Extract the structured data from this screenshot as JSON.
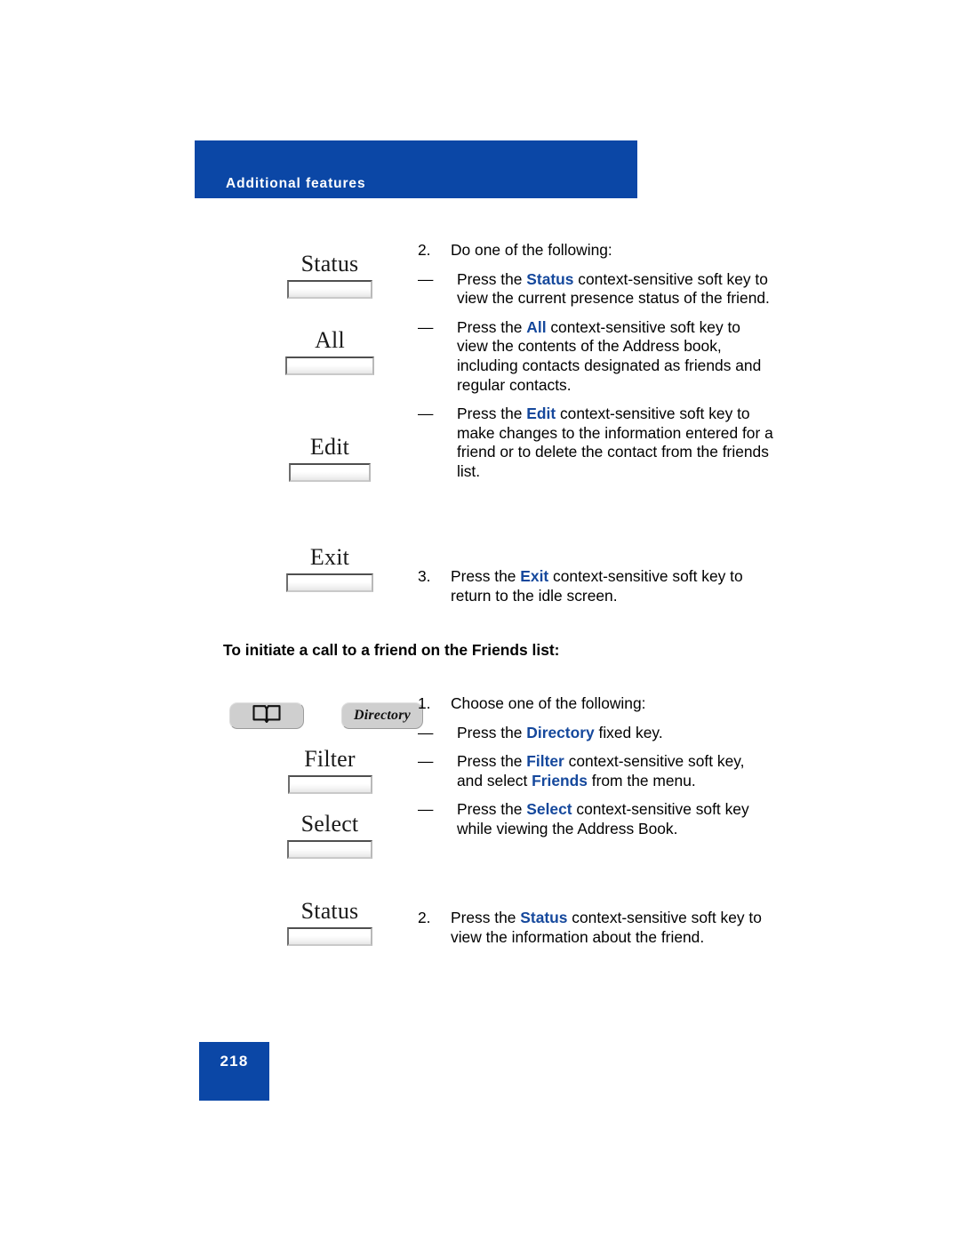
{
  "header": {
    "title": "Additional features"
  },
  "footer": {
    "page_number": "218"
  },
  "colors": {
    "brand_blue": "#0B47A6",
    "keyword_blue": "#15489C",
    "key_pill_gray": "#CFCFCF"
  },
  "softkeys": [
    {
      "label": "Status",
      "name": "softkey-status-1"
    },
    {
      "label": "All",
      "name": "softkey-all"
    },
    {
      "label": "Edit",
      "name": "softkey-edit"
    },
    {
      "label": "Exit",
      "name": "softkey-exit"
    },
    {
      "label": "Filter",
      "name": "softkey-filter"
    },
    {
      "label": "Select",
      "name": "softkey-select"
    },
    {
      "label": "Status",
      "name": "softkey-status-2"
    }
  ],
  "fixed_keys": {
    "book_icon_name": "directory-book-icon",
    "directory_label": "Directory"
  },
  "section_heading": "To initiate a call to a friend on the Friends list:",
  "steps": {
    "step2": {
      "number": "2.",
      "text": "Do one of the following:",
      "bullets": [
        {
          "dash": "—",
          "parts": [
            {
              "t": "Press the ",
              "kw": false
            },
            {
              "t": "Status",
              "kw": true
            },
            {
              "t": " context-sensitive soft key to view the current presence status of the friend.",
              "kw": false
            }
          ]
        },
        {
          "dash": "—",
          "parts": [
            {
              "t": "Press the ",
              "kw": false
            },
            {
              "t": "All",
              "kw": true
            },
            {
              "t": " context-sensitive soft key to view the contents of the Address book, including contacts designated as friends and regular contacts.",
              "kw": false
            }
          ]
        },
        {
          "dash": "—",
          "parts": [
            {
              "t": "Press the ",
              "kw": false
            },
            {
              "t": "Edit",
              "kw": true
            },
            {
              "t": " context-sensitive soft key to make changes to the information entered for a friend or to delete the contact from the friends list.",
              "kw": false
            }
          ]
        }
      ]
    },
    "step3": {
      "number": "3.",
      "parts": [
        {
          "t": "Press the ",
          "kw": false
        },
        {
          "t": "Exit",
          "kw": true
        },
        {
          "t": " context-sensitive soft key to return to the idle screen.",
          "kw": false
        }
      ]
    },
    "step1b": {
      "number": "1.",
      "text": "Choose one of the following:",
      "bullets": [
        {
          "dash": "—",
          "parts": [
            {
              "t": "Press the ",
              "kw": false
            },
            {
              "t": "Directory",
              "kw": true
            },
            {
              "t": " fixed key.",
              "kw": false
            }
          ]
        },
        {
          "dash": "—",
          "parts": [
            {
              "t": "Press the ",
              "kw": false
            },
            {
              "t": "Filter",
              "kw": true
            },
            {
              "t": " context-sensitive soft key, and select ",
              "kw": false
            },
            {
              "t": "Friends",
              "kw": true
            },
            {
              "t": " from the menu.",
              "kw": false
            }
          ]
        },
        {
          "dash": "—",
          "parts": [
            {
              "t": "Press the ",
              "kw": false
            },
            {
              "t": "Select",
              "kw": true
            },
            {
              "t": " context-sensitive soft key while viewing the Address Book.",
              "kw": false
            }
          ]
        }
      ]
    },
    "step2b": {
      "number": "2.",
      "parts": [
        {
          "t": "Press the ",
          "kw": false
        },
        {
          "t": "Status",
          "kw": true
        },
        {
          "t": " context-sensitive soft key to view the information about the friend.",
          "kw": false
        }
      ]
    }
  }
}
